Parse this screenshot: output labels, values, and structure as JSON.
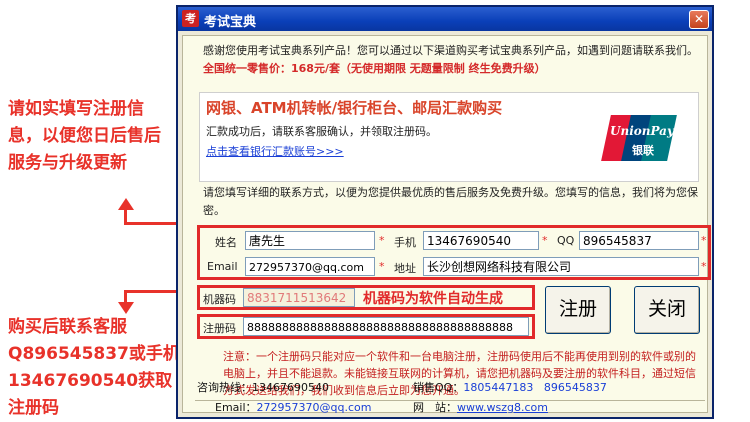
{
  "side_notes": {
    "top": "请如实填写注册信息，以便您日后售后服务与升级更新",
    "bottom": "购买后联系客服Q896545837或手机13467690540获取注册码"
  },
  "window": {
    "title": "考试宝典",
    "icon_char": "考",
    "close_glyph": "✕"
  },
  "intro": {
    "text": "感谢您使用考试宝典系列产品！您可以通过以下渠道购买考试宝典系列产品，如遇到问题请联系我们。",
    "price": "全国统一零售价：168元/套（无使用期限 无题量限制 终生免费升级）"
  },
  "banner": {
    "headline": "网银、ATM机转帐/银行柜台、邮局汇款购买",
    "sub": "汇款成功后，请联系客服确认，并领取注册码。",
    "link": "点击查看银行汇款账号>>>",
    "logo_text1": "UnionPay",
    "logo_text2": "银联"
  },
  "info_text": "请您填写详细的联系方式，以便为您提供最优质的售后服务及免费升级。您填写的信息，我们将为您保密。",
  "form": {
    "name_label": "姓名",
    "name_value": "唐先生",
    "phone_label": "手机",
    "phone_value": "13467690540",
    "qq_label": "QQ",
    "qq_value": "896545837",
    "email_label": "Email",
    "email_value": "272957370@qq.com",
    "address_label": "地址",
    "address_value": "长沙创想网络科技有限公司",
    "required_mark": "*",
    "machine_label": "机器码",
    "machine_value": "8831711513642",
    "machine_note": "机器码为软件自动生成",
    "reg_label": "注册码",
    "reg_value": "88888888888888888888888888888888888888"
  },
  "buttons": {
    "register": "注册",
    "close": "关闭"
  },
  "notice": "注意：一个注册码只能对应一个软件和一台电脑注册，注册码使用后不能再使用到别的软件或别的电脑上，并且不能退款。未能链接互联网的计算机，请您把机器码及要注册的软件科目，通过短信方式发送给我们，我们收到信息后立即为您开通。",
  "footer": {
    "hotline_label": "咨询热线：",
    "hotline_value": "13467690540",
    "sales_qq_label": "销售QQ：",
    "sales_qq_value1": "1805447183",
    "sales_qq_value2": "896545837",
    "email_label": "Email：",
    "email_value": "272957370@qq.com",
    "website_label": "网　站：",
    "website_value": "www.wszg8.com"
  }
}
